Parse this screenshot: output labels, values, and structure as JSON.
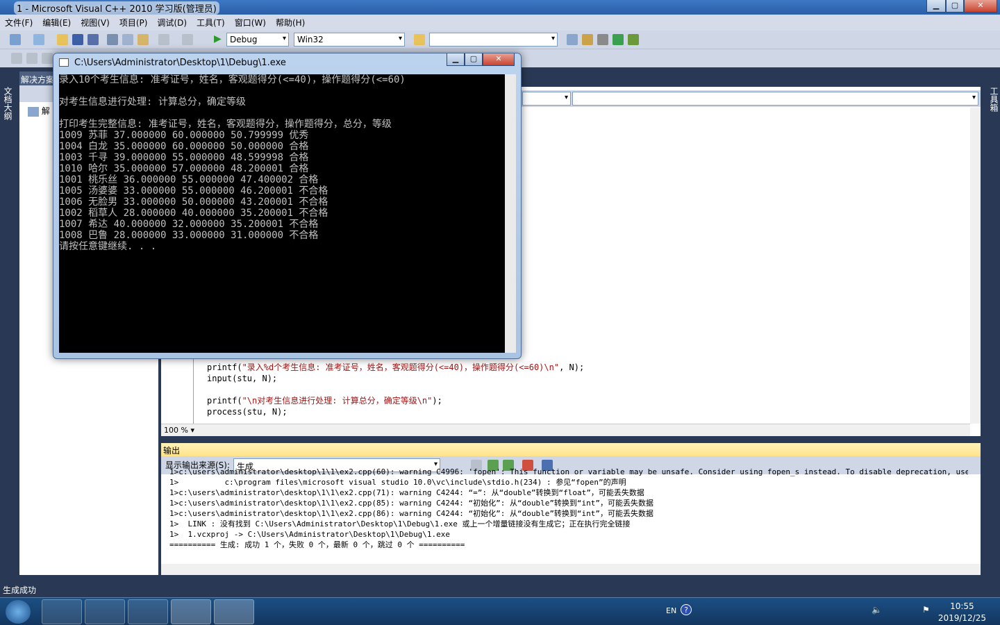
{
  "window": {
    "title": "1 - Microsoft Visual C++ 2010 学习版(管理员)",
    "min": "▁",
    "max": "▢",
    "close": "✕"
  },
  "menu": [
    "文件(F)",
    "编辑(E)",
    "视图(V)",
    "项目(P)",
    "调试(D)",
    "工具(T)",
    "窗口(W)",
    "帮助(H)"
  ],
  "toolbar": {
    "config": "Debug",
    "platform": "Win32",
    "find": ""
  },
  "left_strip": {
    "label": "文档大纲"
  },
  "right_strip": {
    "label": "工具箱"
  },
  "solution_explorer": {
    "title": "解决方案",
    "item": "解"
  },
  "editor": {
    "code": [
      {
        "pre": "printf(",
        "str": "\"录入%d个考生信息: 准考证号，姓名，客观题得分(<=40)，操作题得分(<=60)\\n\"",
        "post": ", N);"
      },
      {
        "pre": "input(stu, N);",
        "str": "",
        "post": ""
      },
      {
        "pre": "",
        "str": "",
        "post": ""
      },
      {
        "pre": "printf(",
        "str": "\"\\n对考生信息进行处理: 计算总分，确定等级\\n\"",
        "post": ");"
      },
      {
        "pre": "process(stu, N);",
        "str": "",
        "post": ""
      }
    ],
    "zoom": "100 %"
  },
  "output": {
    "title": "输出",
    "source_label": "显示输出来源(S):",
    "source": "生成",
    "lines": [
      "1>c:\\users\\administrator\\desktop\\1\\1\\ex2.cpp(60): warning C4996: 'fopen': This function or variable may be unsafe. Consider using fopen_s instead. To disable deprecation, use _CRT_SECURE_NO_WA",
      "1>          c:\\program files\\microsoft visual studio 10.0\\vc\\include\\stdio.h(234) : 参见“fopen”的声明",
      "1>c:\\users\\administrator\\desktop\\1\\1\\ex2.cpp(71): warning C4244: “=”: 从“double”转换到“float”，可能丢失数据",
      "1>c:\\users\\administrator\\desktop\\1\\1\\ex2.cpp(85): warning C4244: “初始化”: 从“double”转换到“int”，可能丢失数据",
      "1>c:\\users\\administrator\\desktop\\1\\1\\ex2.cpp(86): warning C4244: “初始化”: 从“double”转换到“int”，可能丢失数据",
      "1>  LINK : 没有找到 C:\\Users\\Administrator\\Desktop\\1\\Debug\\1.exe 或上一个增量链接没有生成它；正在执行完全链接",
      "1>  1.vcxproj -> C:\\Users\\Administrator\\Desktop\\1\\Debug\\1.exe",
      "========== 生成: 成功 1 个，失败 0 个，最新 0 个，跳过 0 个 =========="
    ]
  },
  "status": "生成成功",
  "console": {
    "title": "C:\\Users\\Administrator\\Desktop\\1\\Debug\\1.exe",
    "lines": [
      "录入10个考生信息: 准考证号，姓名，客观题得分(<=40)，操作题得分(<=60)",
      "",
      "对考生信息进行处理: 计算总分，确定等级",
      "",
      "打印考生完整信息: 准考证号，姓名，客观题得分，操作题得分，总分，等级",
      "1009 苏菲 37.000000 60.000000 50.799999 优秀",
      "1004 白龙 35.000000 60.000000 50.000000 合格",
      "1003 千寻 39.000000 55.000000 48.599998 合格",
      "1010 哈尔 35.000000 57.000000 48.200001 合格",
      "1001 桃乐丝 36.000000 55.000000 47.400002 合格",
      "1005 汤婆婆 33.000000 55.000000 46.200001 不合格",
      "1006 无脸男 33.000000 50.000000 43.200001 不合格",
      "1002 稻草人 28.000000 40.000000 35.200001 不合格",
      "1007 希达 40.000000 32.000000 35.200001 不合格",
      "1008 巴鲁 28.000000 33.000000 31.000000 不合格",
      "请按任意键继续. . ."
    ]
  },
  "taskbar": {
    "lang": "EN",
    "time": "10:55",
    "date": "2019/12/25"
  }
}
